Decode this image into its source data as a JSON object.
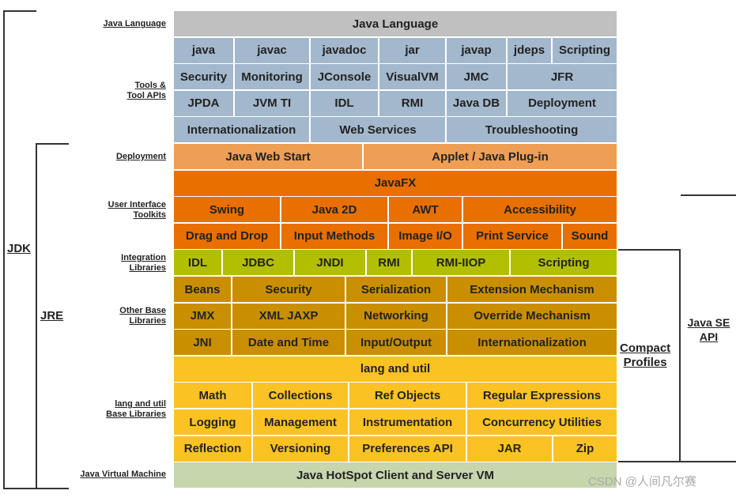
{
  "colors": {
    "java_language": "#c0c0c0",
    "tools": "#a3b8cc",
    "deployment": "#ee9e55",
    "ui_toolkits": "#e86f00",
    "integration": "#b2bf00",
    "other_base": "#c98f00",
    "lang_util": "#fbc224",
    "jvm": "#c6d6ad"
  },
  "left_labels": {
    "java_language": "Java Language",
    "tools_line1": "Tools &",
    "tools_line2": "Tool APIs",
    "deployment": "Deployment",
    "ui_line1": "User Interface",
    "ui_line2": "Toolkits",
    "integration_line1": "Integration",
    "integration_line2": "Libraries",
    "other_line1": "Other Base",
    "other_line2": "Libraries",
    "lang_line1": "lang and util",
    "lang_line2": "Base Libraries",
    "jvm": "Java Virtual Machine"
  },
  "brackets": {
    "jdk": "JDK",
    "jre": "JRE",
    "compact_line1": "Compact",
    "compact_line2": "Profiles",
    "javase_line1": "Java SE",
    "javase_line2": "API"
  },
  "rows": [
    {
      "group": "java_language",
      "cells": [
        "Java Language"
      ]
    },
    {
      "group": "tools",
      "cells": [
        "java",
        "javac",
        "javadoc",
        "jar",
        "javap",
        "jdeps",
        "Scripting"
      ]
    },
    {
      "group": "tools",
      "cells": [
        "Security",
        "Monitoring",
        "JConsole",
        "VisualVM",
        "JMC",
        "JFR"
      ]
    },
    {
      "group": "tools",
      "cells": [
        "JPDA",
        "JVM TI",
        "IDL",
        "RMI",
        "Java DB",
        "Deployment"
      ]
    },
    {
      "group": "tools",
      "cells": [
        "Internationalization",
        "Web Services",
        "Troubleshooting"
      ]
    },
    {
      "group": "deployment",
      "cells": [
        "Java Web Start",
        "Applet / Java Plug-in"
      ]
    },
    {
      "group": "ui_toolkits",
      "cells": [
        "JavaFX"
      ]
    },
    {
      "group": "ui_toolkits",
      "cells": [
        "Swing",
        "Java 2D",
        "AWT",
        "Accessibility"
      ]
    },
    {
      "group": "ui_toolkits",
      "cells": [
        "Drag and Drop",
        "Input Methods",
        "Image I/O",
        "Print Service",
        "Sound"
      ]
    },
    {
      "group": "integration",
      "cells": [
        "IDL",
        "JDBC",
        "JNDI",
        "RMI",
        "RMI-IIOP",
        "Scripting"
      ]
    },
    {
      "group": "other_base",
      "cells": [
        "Beans",
        "Security",
        "Serialization",
        "Extension Mechanism"
      ]
    },
    {
      "group": "other_base",
      "cells": [
        "JMX",
        "XML JAXP",
        "Networking",
        "Override Mechanism"
      ]
    },
    {
      "group": "other_base",
      "cells": [
        "JNI",
        "Date and Time",
        "Input/Output",
        "Internationalization"
      ]
    },
    {
      "group": "lang_util",
      "cells": [
        "lang and util"
      ]
    },
    {
      "group": "lang_util",
      "cells": [
        "Math",
        "Collections",
        "Ref Objects",
        "Regular Expressions"
      ]
    },
    {
      "group": "lang_util",
      "cells": [
        "Logging",
        "Management",
        "Instrumentation",
        "Concurrency Utilities"
      ]
    },
    {
      "group": "lang_util",
      "cells": [
        "Reflection",
        "Versioning",
        "Preferences API",
        "JAR",
        "Zip"
      ]
    },
    {
      "group": "jvm",
      "cells": [
        "Java HotSpot Client and Server VM"
      ]
    }
  ],
  "watermark": "CSDN @人间凡尔赛"
}
